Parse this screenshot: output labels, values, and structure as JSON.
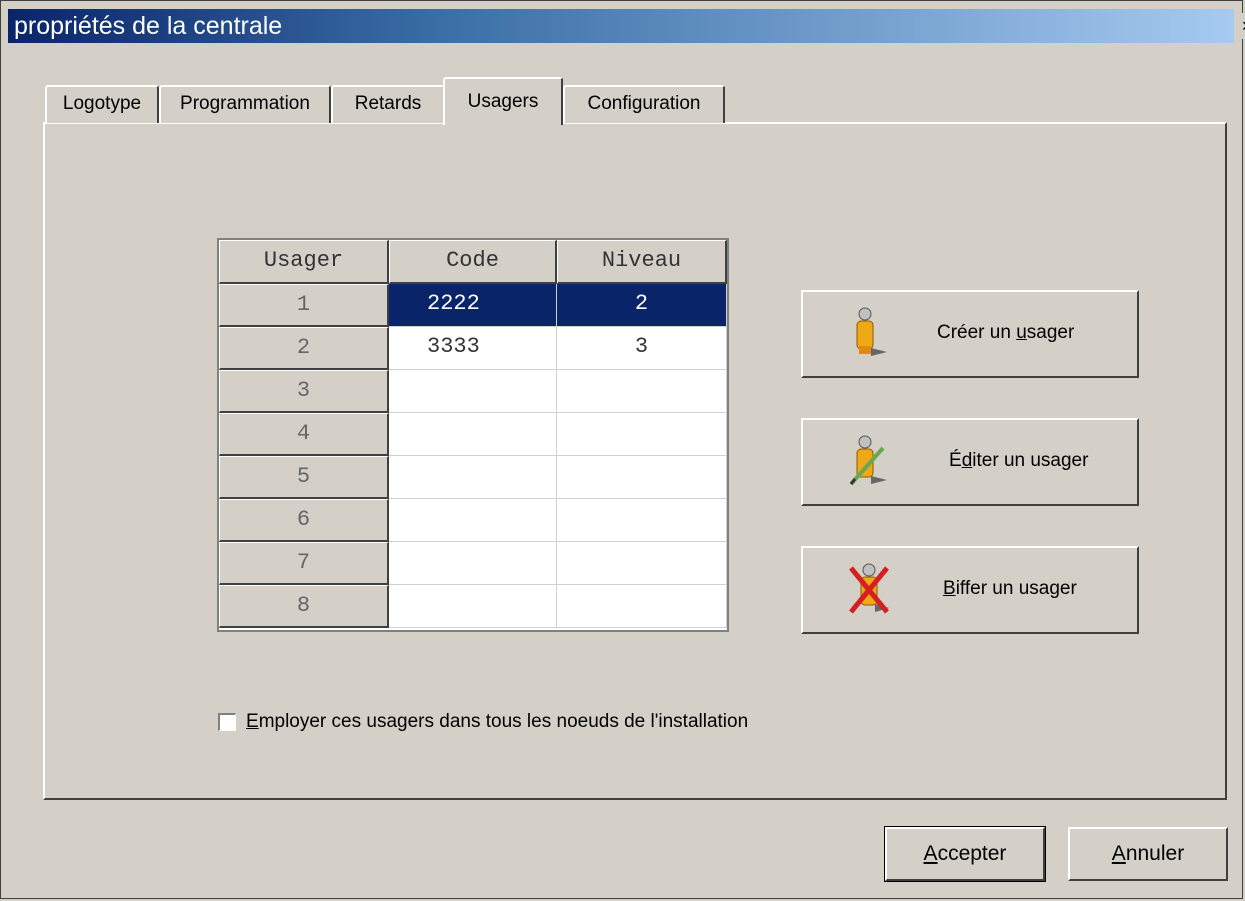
{
  "window": {
    "title": "propriétés de la centrale",
    "close_glyph": "×"
  },
  "tabs": [
    {
      "label": "Logotype"
    },
    {
      "label": "Programmation"
    },
    {
      "label": "Retards"
    },
    {
      "label": "Usagers",
      "active": true
    },
    {
      "label": "Configuration"
    }
  ],
  "table": {
    "columns": [
      "Usager",
      "Code",
      "Niveau"
    ],
    "rows": [
      {
        "usager": "1",
        "code": "2222",
        "niveau": "2",
        "selected": true
      },
      {
        "usager": "2",
        "code": "3333",
        "niveau": "3"
      },
      {
        "usager": "3",
        "code": "",
        "niveau": ""
      },
      {
        "usager": "4",
        "code": "",
        "niveau": ""
      },
      {
        "usager": "5",
        "code": "",
        "niveau": ""
      },
      {
        "usager": "6",
        "code": "",
        "niveau": ""
      },
      {
        "usager": "7",
        "code": "",
        "niveau": ""
      },
      {
        "usager": "8",
        "code": "",
        "niveau": ""
      }
    ]
  },
  "actions": {
    "create": {
      "pre": "Créer un ",
      "key": "u",
      "post": "sager",
      "icon": "user-icon"
    },
    "edit": {
      "pre": "É",
      "key": "d",
      "post": "iter un usager",
      "icon": "edit-user-icon"
    },
    "delete": {
      "pre": "",
      "key": "B",
      "post": "iffer un usager",
      "icon": "delete-user-icon"
    }
  },
  "option": {
    "key": "E",
    "rest": "mployer ces usagers dans tous les noeuds de l'installation",
    "checked": false
  },
  "footer": {
    "accept": {
      "key": "A",
      "rest": "ccepter"
    },
    "cancel": {
      "key": "A",
      "rest": "nnuler"
    }
  },
  "colors": {
    "selection": "#0a246a",
    "face": "#d4d0c8",
    "title_start": "#0a246a"
  }
}
